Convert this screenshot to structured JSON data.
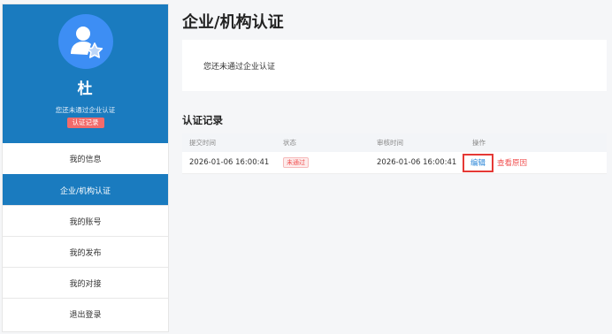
{
  "sidebar": {
    "user_name": "杜",
    "cert_status": "您还未通过企业认证",
    "cert_record_button": "认证记录",
    "menu": [
      {
        "label": "我的信息",
        "active": false
      },
      {
        "label": "企业/机构认证",
        "active": true
      },
      {
        "label": "我的账号",
        "active": false
      },
      {
        "label": "我的发布",
        "active": false
      },
      {
        "label": "我的对接",
        "active": false
      },
      {
        "label": "退出登录",
        "active": false
      }
    ]
  },
  "main": {
    "title": "企业/机构认证",
    "notice": "您还未通过企业认证",
    "records_title": "认证记录",
    "table": {
      "headers": [
        "提交时间",
        "状态",
        "审核时间",
        "操作"
      ],
      "rows": [
        {
          "submit_time": "2026-01-06 16:00:41",
          "status": "未通过",
          "review_time": "2026-01-06 16:00:41",
          "edit": "编辑",
          "view_reason": "查看原因"
        }
      ]
    }
  },
  "colors": {
    "brand_blue": "#1a7bbf",
    "avatar_blue": "#3d8ef4",
    "danger_red": "#f05050",
    "link_blue": "#2a86d8"
  },
  "icons": {
    "avatar": "user-star-icon"
  }
}
